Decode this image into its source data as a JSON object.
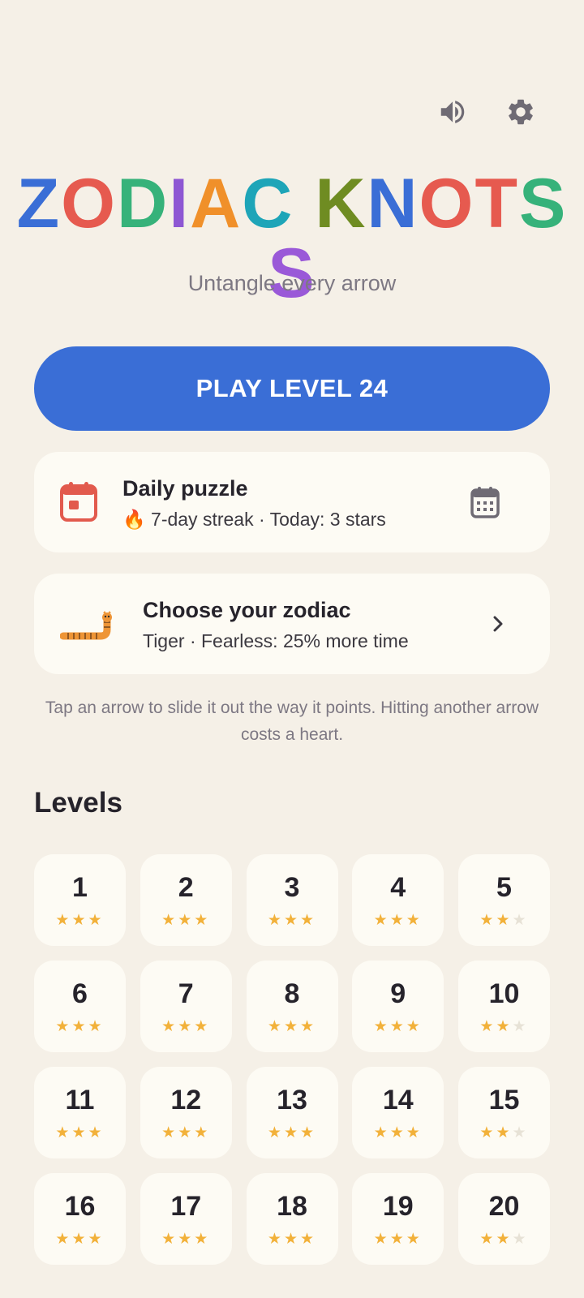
{
  "header": {
    "title_letters": [
      {
        "ch": "Z",
        "color": "#3a6ed6"
      },
      {
        "ch": "O",
        "color": "#e65a4f"
      },
      {
        "ch": "D",
        "color": "#36b27a"
      },
      {
        "ch": "I",
        "color": "#8e57d3"
      },
      {
        "ch": "A",
        "color": "#f0902a"
      },
      {
        "ch": "C",
        "color": "#1ea5b8"
      },
      {
        "ch": " ",
        "color": "#000000"
      },
      {
        "ch": "K",
        "color": "#6f8c22"
      },
      {
        "ch": "N",
        "color": "#3a6ed6"
      },
      {
        "ch": "O",
        "color": "#e65a4f"
      },
      {
        "ch": "T",
        "color": "#e65a4f"
      },
      {
        "ch": "S",
        "color": "#36b27a"
      },
      {
        "ch": "S",
        "color": "#9a59d8"
      }
    ],
    "subtitle": "Untangle every arrow",
    "sound_icon": "speaker-icon",
    "settings_icon": "gear-icon"
  },
  "play_button": {
    "label": "PLAY LEVEL 24"
  },
  "daily": {
    "title": "Daily puzzle",
    "subtitle": "🔥 7-day streak · Today: 3 stars",
    "icon": "calendar-icon",
    "trail_icon": "calendar-grid-icon"
  },
  "zodiac": {
    "title": "Choose your zodiac",
    "subtitle": "Tiger · Fearless: 25% more time",
    "icon": "tiger-snake-icon",
    "trail_icon": "chevron-right-icon"
  },
  "hint": "Tap an arrow to slide it out the way it points. Hitting another arrow costs a heart.",
  "levels": {
    "heading": "Levels",
    "items": [
      {
        "label": "1",
        "stars": 3
      },
      {
        "label": "2",
        "stars": 3
      },
      {
        "label": "3",
        "stars": 3
      },
      {
        "label": "4",
        "stars": 3
      },
      {
        "label": "5",
        "stars": 2
      },
      {
        "label": "6",
        "stars": 3
      },
      {
        "label": "7",
        "stars": 3
      },
      {
        "label": "8",
        "stars": 3
      },
      {
        "label": "9",
        "stars": 3
      },
      {
        "label": "10",
        "stars": 2
      },
      {
        "label": "11",
        "stars": 3
      },
      {
        "label": "12",
        "stars": 3
      },
      {
        "label": "13",
        "stars": 3
      },
      {
        "label": "14",
        "stars": 3
      },
      {
        "label": "15",
        "stars": 2
      },
      {
        "label": "16",
        "stars": 3
      },
      {
        "label": "17",
        "stars": 3
      },
      {
        "label": "18",
        "stars": 3
      },
      {
        "label": "19",
        "stars": 3
      },
      {
        "label": "20",
        "stars": 2
      }
    ]
  },
  "colors": {
    "background": "#f5f0e7",
    "card": "#fdfbf4",
    "primary": "#3a6ed6",
    "star": "#f2b13a",
    "star_empty": "#e7e2d6"
  }
}
